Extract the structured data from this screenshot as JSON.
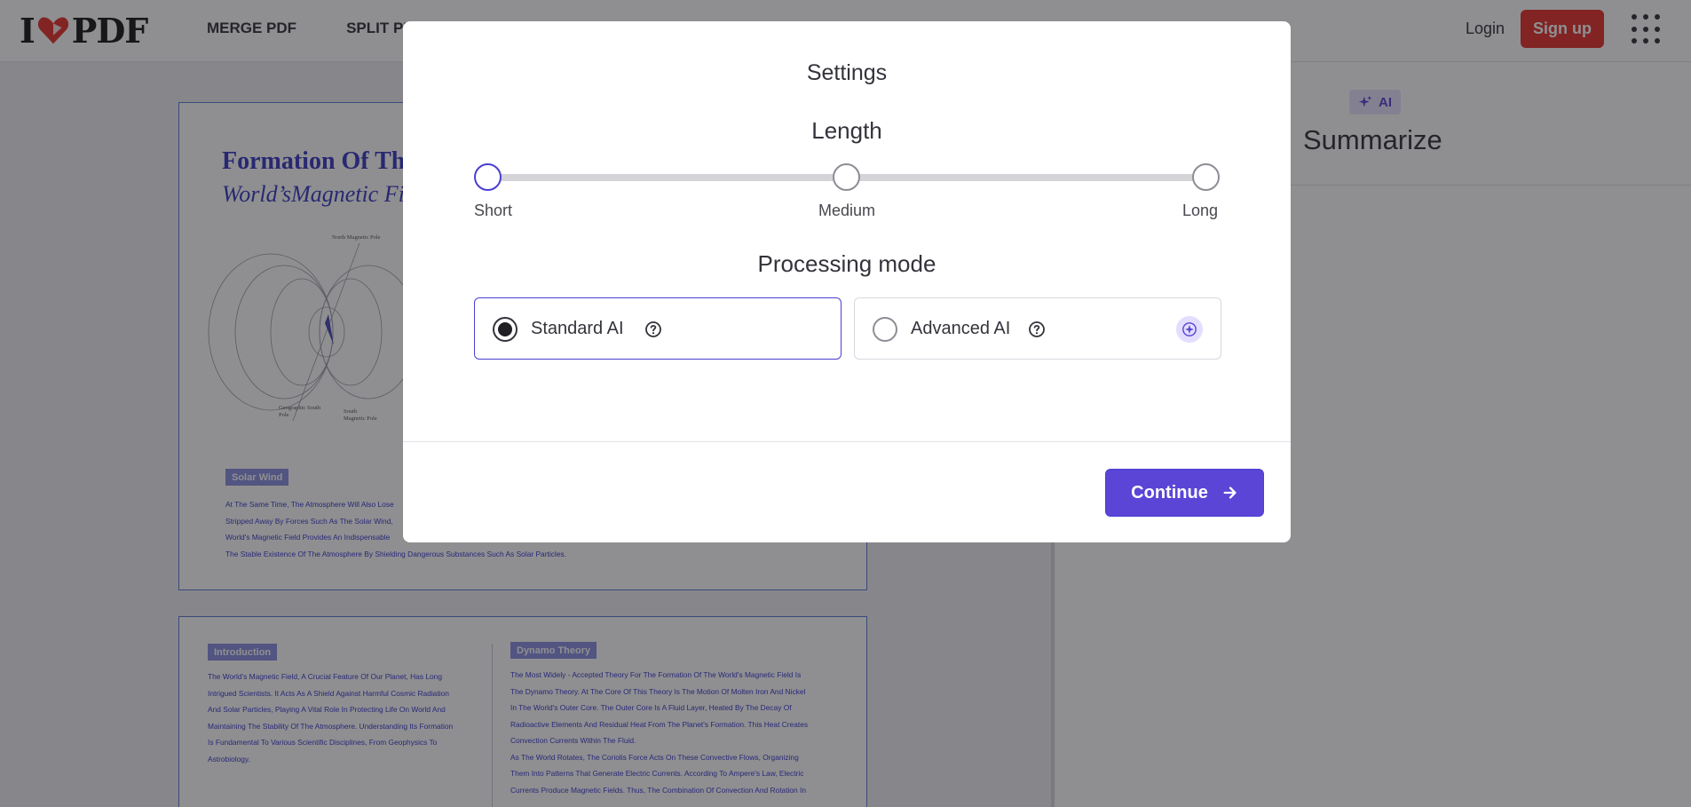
{
  "header": {
    "logo_left": "I",
    "logo_right": "PDF",
    "nav": [
      "MERGE PDF",
      "SPLIT PDF"
    ],
    "login": "Login",
    "signup": "Sign up",
    "brand_color": "#e5322d"
  },
  "side_panel": {
    "badge": "AI",
    "title": "Summarize"
  },
  "document": {
    "page1": {
      "title": "Formation Of The",
      "subtitle": "World’sMagnetic Field",
      "figure_labels": {
        "north": "North Magnetic Pole",
        "geo": "Geographic South Pole",
        "south": "South Magnetic Pole"
      },
      "section": "Solar Wind",
      "lines": [
        "At The Same Time, The Atmosphere Will Also Lose",
        "Stripped Away By Forces Such As The Solar Wind,",
        "World's Magnetic Field Provides An Indispensable",
        "The Stable Existence Of The Atmosphere By Shielding Dangerous Substances Such As Solar Particles."
      ]
    },
    "page2": {
      "left_section": "Introduction",
      "left_lines": [
        "The World's Magnetic Field, A Crucial Feature Of Our Planet, Has Long",
        "Intrigued Scientists. It Acts As A Shield Against Harmful Cosmic Radiation",
        "And Solar Particles, Playing A Vital Role In Protecting Life On World And",
        "Maintaining The Stability Of The Atmosphere. Understanding Its Formation",
        "Is Fundamental To Various Scientific Disciplines, From Geophysics To",
        "Astrobiology."
      ],
      "right_section": "Dynamo Theory",
      "right_lines": [
        "The Most Widely - Accepted Theory For The Formation Of The World's Magnetic Field Is",
        "The Dynamo Theory. At The Core Of This Theory Is The Motion Of Molten Iron And Nickel",
        "In The World's Outer Core. The Outer Core Is A Fluid Layer, Heated By The Decay Of",
        "Radioactive Elements And Residual Heat From The Planet's Formation. This Heat Creates",
        "Convection Currents Within The Fluid.",
        "As The World Rotates, The Coriolis Force Acts On These Convective Flows, Organizing",
        "Them Into Patterns That Generate Electric Currents. According To Ampere's Law, Electric",
        "Currents Produce Magnetic Fields. Thus, The Combination Of Convection And Rotation In"
      ]
    }
  },
  "modal": {
    "title": "Settings",
    "length_heading": "Length",
    "length_options": [
      "Short",
      "Medium",
      "Long"
    ],
    "length_selected": "Short",
    "mode_heading": "Processing mode",
    "modes": [
      {
        "label": "Standard AI",
        "selected": true
      },
      {
        "label": "Advanced AI",
        "selected": false,
        "premium": true
      }
    ],
    "continue": "Continue",
    "accent_color": "#5a45d6"
  }
}
